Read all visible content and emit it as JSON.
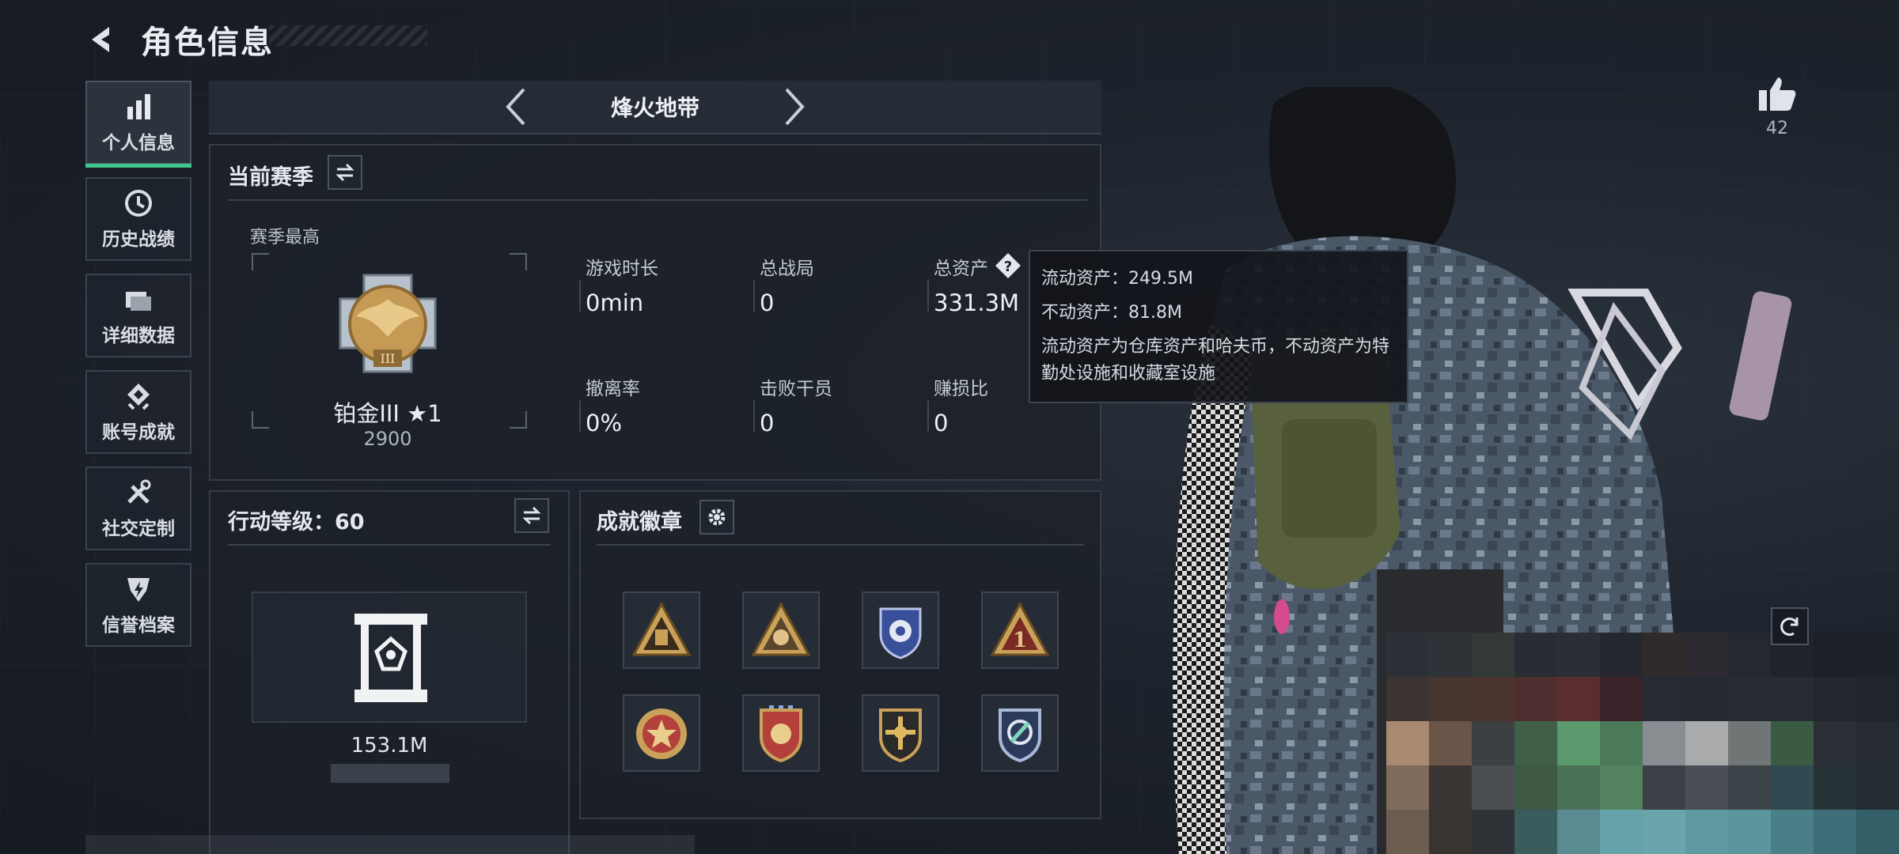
{
  "header": {
    "title": "角色信息"
  },
  "sidebar": {
    "items": [
      {
        "label": "个人信息",
        "icon": "bar-chart-icon",
        "active": true
      },
      {
        "label": "历史战绩",
        "icon": "history-icon"
      },
      {
        "label": "详细数据",
        "icon": "folder-icon"
      },
      {
        "label": "账号成就",
        "icon": "achievement-icon"
      },
      {
        "label": "社交定制",
        "icon": "tools-icon"
      },
      {
        "label": "信誉档案",
        "icon": "credit-shield-icon"
      }
    ]
  },
  "mode": {
    "title": "烽火地带"
  },
  "season": {
    "title": "当前赛季",
    "best_label": "赛季最高",
    "rank_name": "铂金III ★1",
    "rank_score": "2900",
    "stats": [
      {
        "label": "游戏时长",
        "value": "0min"
      },
      {
        "label": "总战局",
        "value": "0"
      },
      {
        "label": "总资产",
        "value": "331.3M"
      },
      {
        "label": "撤离率",
        "value": "0%"
      },
      {
        "label": "击败干员",
        "value": "0"
      },
      {
        "label": "赚损比",
        "value": "0"
      }
    ]
  },
  "tooltip": {
    "liquid": "流动资产：249.5M",
    "fixed": "不动资产：81.8M",
    "description": "流动资产为仓库资产和哈夫币，不动资产为特勤处设施和收藏室设施"
  },
  "action_level": {
    "title": "行动等级：60",
    "value": "153.1M"
  },
  "achievements": {
    "title": "成就徽章",
    "badges": [
      "badge-1",
      "badge-2",
      "badge-3",
      "badge-4",
      "badge-5",
      "badge-6",
      "badge-7",
      "badge-8"
    ]
  },
  "likes": {
    "count": "42"
  },
  "colors": {
    "accent": "#3ec78f",
    "gold": "#c9a15a",
    "panel": "#1c2129"
  }
}
